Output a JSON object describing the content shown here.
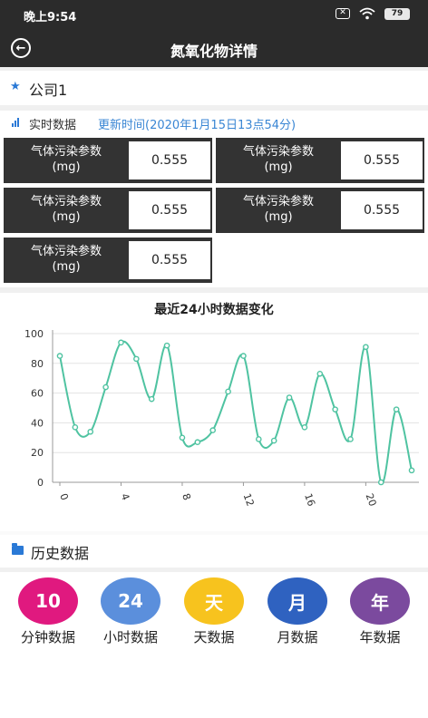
{
  "status_bar": {
    "time": "晚上9:54",
    "battery": "79"
  },
  "header": {
    "title": "氮氧化物详情"
  },
  "company": {
    "name": "公司1"
  },
  "realtime": {
    "label": "实时数据",
    "update_time": "更新时间(2020年1月15日13点54分)"
  },
  "params": [
    {
      "label": "气体污染参数",
      "unit": "(mg)",
      "value": "0.555"
    },
    {
      "label": "气体污染参数",
      "unit": "(mg)",
      "value": "0.555"
    },
    {
      "label": "气体污染参数",
      "unit": "(mg)",
      "value": "0.555"
    },
    {
      "label": "气体污染参数",
      "unit": "(mg)",
      "value": "0.555"
    },
    {
      "label": "气体污染参数",
      "unit": "(mg)",
      "value": "0.555"
    }
  ],
  "chart_data": {
    "type": "line",
    "title": "最近24小时数据变化",
    "x": [
      0,
      1,
      2,
      3,
      4,
      5,
      6,
      7,
      8,
      9,
      10,
      11,
      12,
      13,
      14,
      15,
      16,
      17,
      18,
      19,
      20,
      21,
      22,
      23
    ],
    "values": [
      85,
      37,
      34,
      64,
      94,
      83,
      56,
      92,
      30,
      27,
      35,
      61,
      85,
      29,
      28,
      57,
      37,
      73,
      49,
      29,
      91,
      0,
      49,
      8
    ],
    "xticks": [
      "0",
      "4",
      "8",
      "12",
      "16",
      "20"
    ],
    "yticks": [
      "0",
      "20",
      "40",
      "60",
      "80",
      "100"
    ],
    "ylim": [
      0,
      100
    ],
    "grid": true,
    "line_color": "#4fc3a1"
  },
  "history": {
    "label": "历史数据",
    "items": [
      {
        "label": "分钟数据",
        "icon_text": "10",
        "icon": "clock-icon",
        "color": "#e0197f"
      },
      {
        "label": "小时数据",
        "icon_text": "24",
        "icon": "recycle-24-icon",
        "color": "#5b8fdc"
      },
      {
        "label": "天数据",
        "icon_text": "天",
        "icon": "calendar-day-icon",
        "color": "#f7c31e"
      },
      {
        "label": "月数据",
        "icon_text": "月",
        "icon": "calendar-month-icon",
        "color": "#2f62c0"
      },
      {
        "label": "年数据",
        "icon_text": "年",
        "icon": "calendar-year-icon",
        "color": "#7b4a9e"
      }
    ]
  }
}
